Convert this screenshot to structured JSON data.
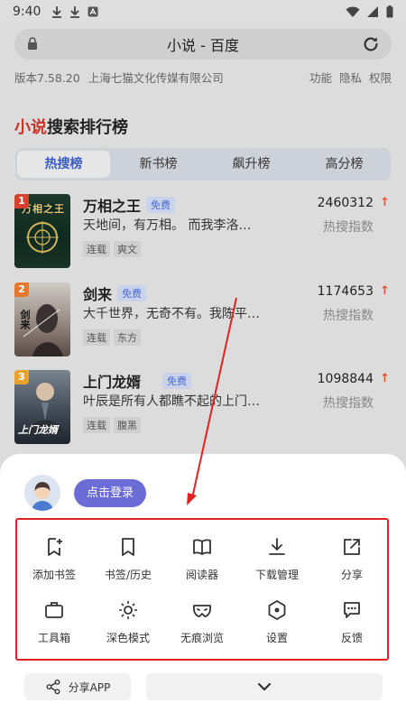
{
  "status_bar": {
    "time": "9:40"
  },
  "browser": {
    "url_title": "小说 - 百度"
  },
  "app_info": {
    "version": "版本7.58.20",
    "company": "上海七猫文化传媒有限公司",
    "links": [
      "功能",
      "隐私",
      "权限"
    ]
  },
  "ranking": {
    "title_red": "小说",
    "title_rest": "搜索排行榜",
    "tabs": [
      "热搜榜",
      "新书榜",
      "飙升榜",
      "高分榜"
    ],
    "books": [
      {
        "rank": "1",
        "title": "万相之王",
        "badge": "免费",
        "desc": "天地间，有万相。 而我李洛…",
        "tags": [
          "连载",
          "爽文"
        ],
        "score": "2460312",
        "score_label": "热搜指数",
        "cover_text": "万相之王"
      },
      {
        "rank": "2",
        "title": "剑来",
        "badge": "免费",
        "desc": "大千世界，无奇不有。我陈平…",
        "tags": [
          "连载",
          "东方"
        ],
        "score": "1174653",
        "score_label": "热搜指数",
        "cover_text": "剑来"
      },
      {
        "rank": "3",
        "title": "上门龙婿",
        "badge": "免费",
        "desc": "叶辰是所有人都瞧不起的上门…",
        "tags": [
          "连载",
          "腹黑"
        ],
        "score": "1098844",
        "score_label": "热搜指数",
        "cover_text": "上门龙婿"
      }
    ]
  },
  "sheet": {
    "login_label": "点击登录",
    "menu": [
      {
        "label": "添加书签",
        "icon": "bookmark-add-icon"
      },
      {
        "label": "书签/历史",
        "icon": "bookmark-icon"
      },
      {
        "label": "阅读器",
        "icon": "open-book-icon"
      },
      {
        "label": "下载管理",
        "icon": "download-icon"
      },
      {
        "label": "分享",
        "icon": "share-external-icon"
      },
      {
        "label": "工具箱",
        "icon": "toolbox-icon"
      },
      {
        "label": "深色模式",
        "icon": "sun-icon"
      },
      {
        "label": "无痕浏览",
        "icon": "mask-icon"
      },
      {
        "label": "设置",
        "icon": "hexagon-settings-icon"
      },
      {
        "label": "反馈",
        "icon": "feedback-bubble-icon"
      }
    ],
    "share_app_label": "分享APP"
  },
  "colors": {
    "accent": "#6b6cd6",
    "rank_title_red": "#c8342a",
    "highlight_box": "#e02323",
    "rank1": "#d9412e",
    "rank2": "#e8772e",
    "rank3": "#e8a22e"
  }
}
